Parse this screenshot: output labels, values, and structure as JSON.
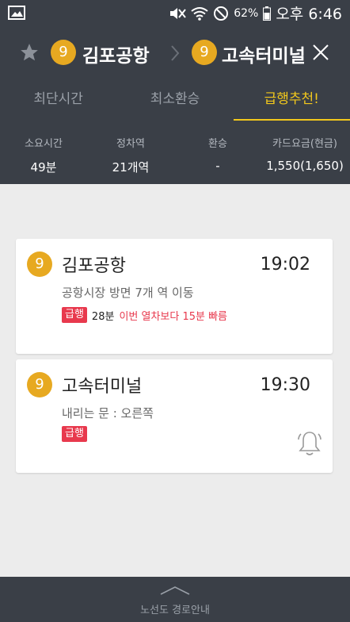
{
  "status_bar": {
    "battery": "62%",
    "time": "오후 6:46"
  },
  "header": {
    "from": {
      "line": "9",
      "station": "김포공항"
    },
    "to": {
      "line": "9",
      "station": "고속터미널"
    }
  },
  "tabs": [
    {
      "label": "최단시간",
      "active": false
    },
    {
      "label": "최소환승",
      "active": false
    },
    {
      "label": "급행추천!",
      "active": true
    }
  ],
  "summary": {
    "duration": {
      "label": "소요시간",
      "value": "49분"
    },
    "stops": {
      "label": "정차역",
      "value": "21개역"
    },
    "transfer": {
      "label": "환승",
      "value": "-"
    },
    "fare": {
      "label": "카드요금(현금)",
      "value": "1,550(1,650)"
    }
  },
  "route": {
    "depart": {
      "line": "9",
      "station": "김포공항",
      "time": "19:02",
      "desc": "공항시장 방면 7개 역 이동",
      "express_label": "급행",
      "minutes": "28분",
      "note": "이번 열차보다 15분 빠름"
    },
    "arrive": {
      "line": "9",
      "station": "고속터미널",
      "time": "19:30",
      "desc": "내리는 문 : 오른쪽",
      "express_label": "급행"
    }
  },
  "bottom": {
    "label": "노선도 경로안내"
  },
  "colors": {
    "bar": "#3a3f47",
    "line9": "#e7a921",
    "accent": "#f2c81c",
    "express": "#e8394d"
  },
  "icons": [
    "image-icon",
    "mute-icon",
    "wifi-icon",
    "no-disturb-icon",
    "battery-icon",
    "star-icon",
    "chevron-right-icon",
    "close-icon",
    "bell-icon",
    "chevron-up-icon"
  ]
}
